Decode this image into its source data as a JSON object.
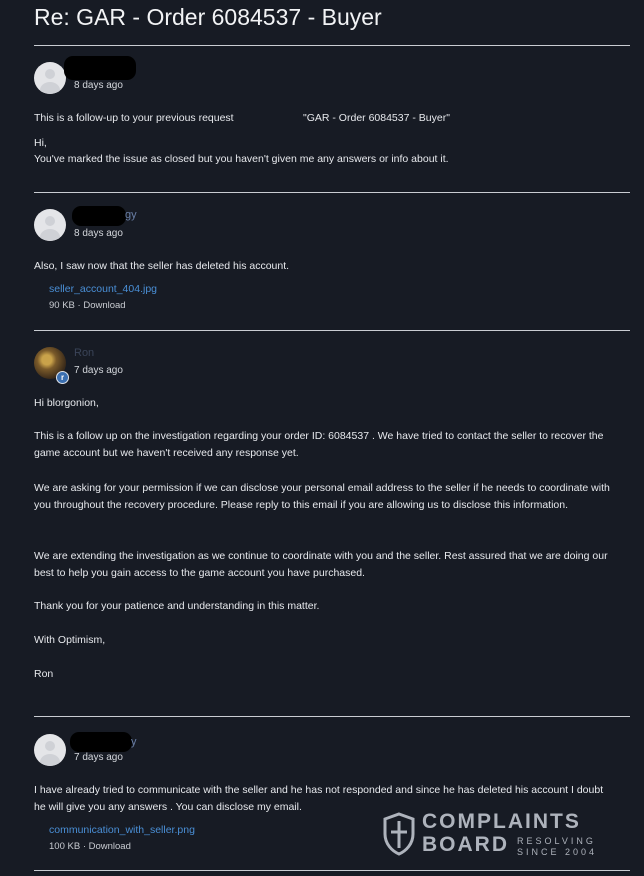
{
  "ticket": {
    "title": "Re: GAR - Order 6084537 - Buyer"
  },
  "messages": [
    {
      "author_visible": "",
      "time": "8 days ago",
      "paragraphs": [
        "This is a follow-up to your previous request",
        "\"GAR - Order 6084537 - Buyer\"",
        "Hi,",
        "You've marked the issue as closed but you haven't given me any answers or info about it."
      ]
    },
    {
      "author_visible": "gy",
      "time": "8 days ago",
      "paragraphs": [
        "Also, I saw now that the seller has deleted his account."
      ],
      "attachment": {
        "name": "seller_account_404.jpg",
        "size": "90 KB",
        "download": "Download"
      }
    },
    {
      "author_visible": "Ron",
      "time": "7 days ago",
      "paragraphs": [
        "Hi blorgonion,",
        "This is a follow up on the investigation regarding your order ID: 6084537 . We have tried to contact the seller to recover the game account but we haven't received any response yet.",
        "We are asking for your permission if we can disclose your personal email address to the seller if he needs to coordinate with you throughout the recovery procedure. Please reply to this email if you are allowing us to disclose this information.",
        "We are extending the investigation as we continue to coordinate with you and the seller. Rest assured that we are doing our best to help you gain access to the game account you have purchased.",
        "Thank you for your patience and understanding in this matter.",
        "With Optimism,",
        "Ron"
      ]
    },
    {
      "author_visible": "y",
      "time": "7 days ago",
      "paragraphs": [
        "I have already tried to communicate with the seller and he has not responded and since he has deleted his account I doubt he will give you any answers . You can disclose my email."
      ],
      "attachment": {
        "name": "communication_with_seller.png",
        "size": "100 KB",
        "download": "Download"
      }
    }
  ],
  "watermark": {
    "line1": "COMPLAINTS",
    "line2": "BOARD",
    "tag1": "RESOLVING",
    "tag2": "SINCE 2004"
  },
  "colors": {
    "background": "#171b24",
    "link": "#4a8fd6",
    "text": "#e7e9ed"
  }
}
